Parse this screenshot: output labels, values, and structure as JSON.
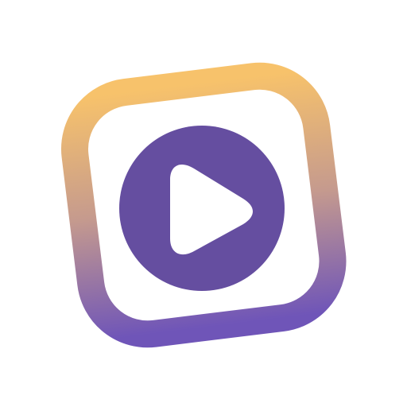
{
  "icon": {
    "name": "play-app-icon",
    "colors": {
      "frame_gradient_top": "#F7C26B",
      "frame_gradient_middle": "#C59A8E",
      "frame_gradient_bottom": "#6F55B8",
      "circle": "#654EA0",
      "play_triangle": "#ffffff",
      "background": "#ffffff"
    }
  }
}
